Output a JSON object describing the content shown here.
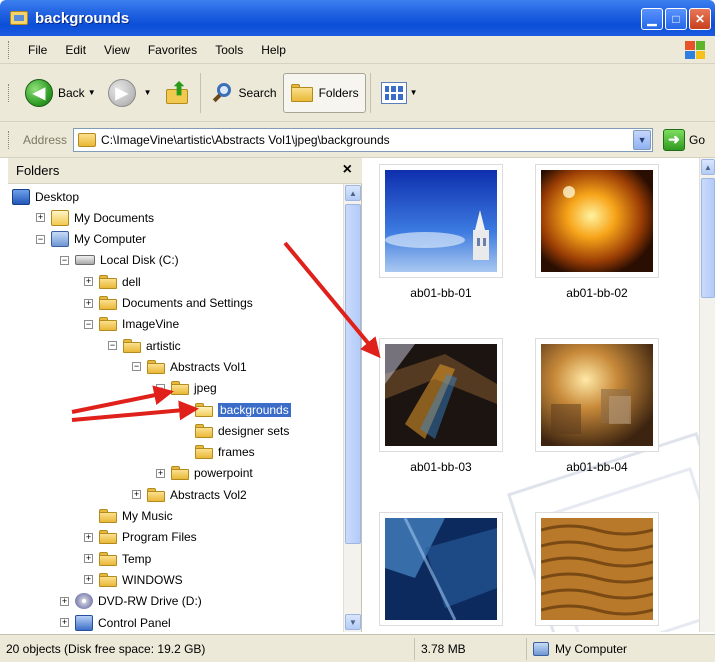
{
  "window": {
    "title": "backgrounds"
  },
  "menu": [
    "File",
    "Edit",
    "View",
    "Favorites",
    "Tools",
    "Help"
  ],
  "toolbar": {
    "back_label": "Back",
    "search_label": "Search",
    "folders_label": "Folders"
  },
  "address": {
    "label": "Address",
    "value": "C:\\ImageVine\\artistic\\Abstracts Vol1\\jpeg\\backgrounds",
    "go_label": "Go"
  },
  "folders_pane": {
    "header": "Folders",
    "close_glyph": "×",
    "tree": [
      {
        "label": "Desktop",
        "icon": "desktop-icon",
        "level": 0,
        "expander": ""
      },
      {
        "label": "My Documents",
        "icon": "my-documents-icon",
        "level": 1,
        "expander": "+"
      },
      {
        "label": "My Computer",
        "icon": "my-computer-icon",
        "level": 1,
        "expander": "−"
      },
      {
        "label": "Local Disk (C:)",
        "icon": "local-disk-icon",
        "level": 2,
        "expander": "−"
      },
      {
        "label": "dell",
        "icon": "folder-icon",
        "level": 3,
        "expander": "+"
      },
      {
        "label": "Documents and Settings",
        "icon": "folder-icon",
        "level": 3,
        "expander": "+"
      },
      {
        "label": "ImageVine",
        "icon": "folder-icon",
        "level": 3,
        "expander": "−"
      },
      {
        "label": "artistic",
        "icon": "folder-icon",
        "level": 4,
        "expander": "−"
      },
      {
        "label": "Abstracts Vol1",
        "icon": "folder-icon",
        "level": 5,
        "expander": "−"
      },
      {
        "label": "jpeg",
        "icon": "folder-icon",
        "level": 6,
        "expander": "−"
      },
      {
        "label": "backgrounds",
        "icon": "open-folder-icon",
        "level": 7,
        "expander": "",
        "selected": true
      },
      {
        "label": "designer sets",
        "icon": "folder-icon",
        "level": 7,
        "expander": ""
      },
      {
        "label": "frames",
        "icon": "folder-icon",
        "level": 7,
        "expander": ""
      },
      {
        "label": "powerpoint",
        "icon": "folder-icon",
        "level": 6,
        "expander": "+"
      },
      {
        "label": "Abstracts Vol2",
        "icon": "folder-icon",
        "level": 5,
        "expander": "+"
      },
      {
        "label": "My Music",
        "icon": "folder-icon",
        "level": 3,
        "expander": ""
      },
      {
        "label": "Program Files",
        "icon": "folder-icon",
        "level": 3,
        "expander": "+"
      },
      {
        "label": "Temp",
        "icon": "folder-icon",
        "level": 3,
        "expander": "+"
      },
      {
        "label": "WINDOWS",
        "icon": "folder-icon",
        "level": 3,
        "expander": "+"
      },
      {
        "label": "DVD-RW Drive (D:)",
        "icon": "dvd-drive-icon",
        "level": 2,
        "expander": "+"
      },
      {
        "label": "Control Panel",
        "icon": "control-panel-icon",
        "level": 2,
        "expander": "+"
      }
    ]
  },
  "thumbnails": [
    {
      "name": "ab01-bb-01",
      "style": "sky-blue"
    },
    {
      "name": "ab01-bb-02",
      "style": "orange-glow"
    },
    {
      "name": "ab01-bb-03",
      "style": "dark-rainbow"
    },
    {
      "name": "ab01-bb-04",
      "style": "sepia-blocks"
    },
    {
      "name": "",
      "style": "blue-panels"
    },
    {
      "name": "",
      "style": "sand-dunes"
    }
  ],
  "status": {
    "objects": "20 objects (Disk free space: 19.2 GB)",
    "size": "3.78 MB",
    "location": "My Computer"
  },
  "colors": {
    "titlebar": "#0b4fd8",
    "chrome": "#ece9d8",
    "selection": "#3a6cc8",
    "annotation_arrow": "#e0201a"
  }
}
